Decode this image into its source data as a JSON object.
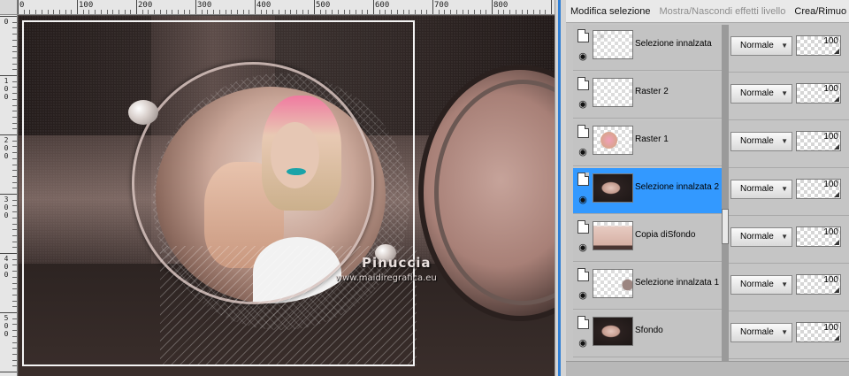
{
  "toolbar": {
    "modify_selection": "Modifica selezione",
    "show_hide_effects": "Mostra/Nascondi effetti livello",
    "create_remove": "Crea/Rimuo"
  },
  "ruler": {
    "top_labels": [
      "0",
      "100",
      "200",
      "300",
      "400",
      "500",
      "600",
      "700",
      "800"
    ],
    "left_labels": [
      "0",
      "1\n0\n0",
      "2\n0\n0",
      "3\n0\n0",
      "4\n0\n0",
      "5\n0\n0"
    ]
  },
  "watermark": {
    "title": "Pinuccia",
    "url": "www.maidiregrafica.eu"
  },
  "layers": [
    {
      "name": "Selezione innalzata",
      "blend": "Normale",
      "opacity": "100",
      "selected": false,
      "thumb": "empty-faint"
    },
    {
      "name": "Raster 2",
      "blend": "Normale",
      "opacity": "100",
      "selected": false,
      "thumb": "empty"
    },
    {
      "name": "Raster 1",
      "blend": "Normale",
      "opacity": "100",
      "selected": false,
      "thumb": "figure"
    },
    {
      "name": "Selezione innalzata 2",
      "blend": "Normale",
      "opacity": "100",
      "selected": true,
      "thumb": "dark-sphere"
    },
    {
      "name": "Copia diSfondo",
      "blend": "Normale",
      "opacity": "100",
      "selected": false,
      "thumb": "pink-fill"
    },
    {
      "name": "Selezione innalzata 1",
      "blend": "Normale",
      "opacity": "100",
      "selected": false,
      "thumb": "empty-edge"
    },
    {
      "name": "Sfondo",
      "blend": "Normale",
      "opacity": "100",
      "selected": false,
      "thumb": "dark-sphere"
    }
  ],
  "colors": {
    "selection": "#3399ff",
    "panel_bg": "#c5c5c5",
    "canvas_bg": "#2a2220"
  },
  "icons": {
    "layer_type": "page-icon",
    "visibility": "eye-icon",
    "dropdown": "chevron-down-icon"
  }
}
